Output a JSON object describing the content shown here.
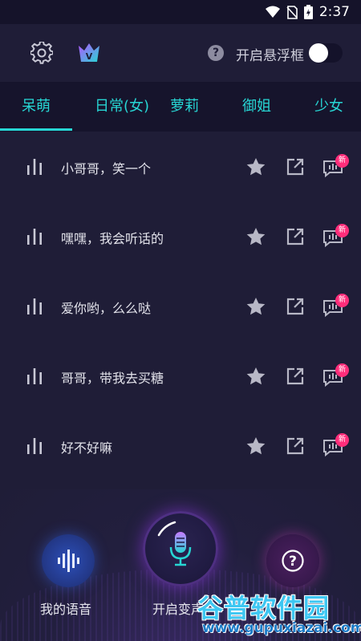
{
  "status": {
    "time": "2:37"
  },
  "header": {
    "float_label": "开启悬浮框",
    "float_toggle_on": false
  },
  "tabs": [
    {
      "label": "呆萌",
      "active": true
    },
    {
      "label": "日常(女)",
      "active": false
    },
    {
      "label": "萝莉",
      "active": false
    },
    {
      "label": "御姐",
      "active": false
    },
    {
      "label": "少女",
      "active": false
    }
  ],
  "items": [
    {
      "text": "小哥哥，笑一个",
      "badge": "新"
    },
    {
      "text": "嘿嘿，我会听话的",
      "badge": "新"
    },
    {
      "text": "爱你哟，么么哒",
      "badge": "新"
    },
    {
      "text": "哥哥，带我去买糖",
      "badge": "新"
    },
    {
      "text": "好不好嘛",
      "badge": "新"
    }
  ],
  "bottom": {
    "my_voice_label": "我的语音",
    "start_label": "开启变声"
  },
  "watermark": {
    "title": "谷普软件园",
    "url": "www.gupuxiazai.com"
  },
  "colors": {
    "accent": "#27d6d4",
    "background": "#1f1d37",
    "badge": "#ff2d7a"
  }
}
